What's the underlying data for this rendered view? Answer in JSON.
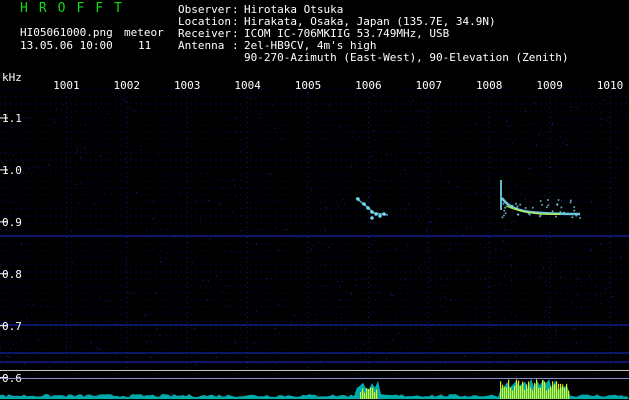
{
  "header": {
    "logo": "HROFFT",
    "filename": "HI05061000.png",
    "meteor_label": "meteor",
    "datetime": "13.05.06 10:00",
    "meteor_count": "11"
  },
  "station": {
    "observer_label": "Observer",
    "observer": "Hirotaka Otsuka",
    "location_label": "Location",
    "location": "Hirakata, Osaka, Japan (135.7E, 34.9N)",
    "receiver_label": "Receiver",
    "receiver": "ICOM IC-706MKIIG 53.749MHz, USB",
    "antenna_label": "Antenna",
    "antenna": "2el-HB9CV, 4m's high",
    "antenna_line2": "90-270-Azimuth (East-West), 90-Elevation (Zenith)"
  },
  "axes": {
    "y_unit": "kHz",
    "y_ticks": [
      "1.1",
      "1.0",
      "0.9",
      "0.8",
      "0.7",
      "0.6"
    ],
    "x_ticks": [
      "1001",
      "1002",
      "1003",
      "1004",
      "1005",
      "1006",
      "1007",
      "1008",
      "1009",
      "1010"
    ]
  },
  "colors": {
    "background": "#000000",
    "logo": "#14d914",
    "grid": "#1a2bd0",
    "echo": "#7fe8ff",
    "trace_cyan": "#00c8c8",
    "trace_yellow": "#ffff00",
    "separator": "#c8c8c8"
  }
}
